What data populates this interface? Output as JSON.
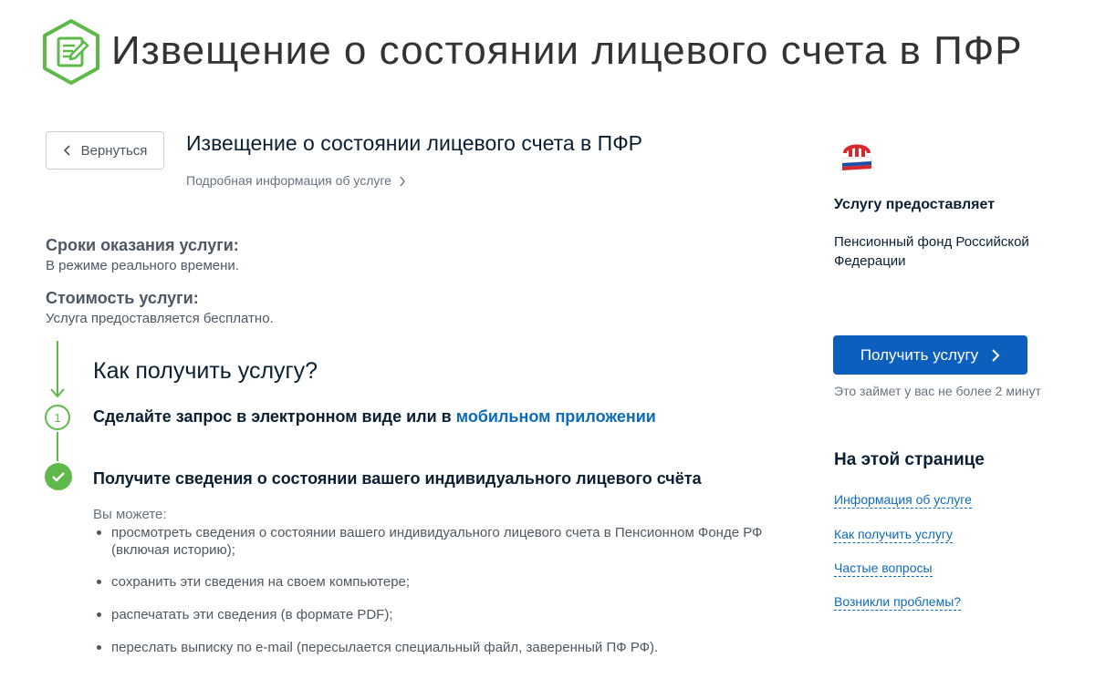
{
  "banner": {
    "title": "Извещение о состоянии лицевого счета в ПФР",
    "icon": "document-edit-icon",
    "accent_color": "#5fb94a"
  },
  "nav": {
    "back_label": "Вернуться"
  },
  "service": {
    "title": "Извещение о состоянии лицевого счета в ПФР",
    "details_link": "Подробная информация об услуге"
  },
  "info": {
    "terms_label": "Сроки оказания услуги:",
    "terms_value": "В режиме реального времени.",
    "cost_label": "Стоимость услуги:",
    "cost_value": "Услуга предоставляется бесплатно."
  },
  "how": {
    "title": "Как получить услугу?",
    "step1_number": "1",
    "step1_text": "Сделайте запрос в электронном виде или в ",
    "step1_link": "мобильном приложении",
    "step2_text": "Получите сведения о состоянии вашего индивидуального лицевого счёта",
    "can_label": "Вы можете:",
    "bullets": [
      "просмотреть сведения о состоянии вашего индивидуального лицевого счета в Пенсионном Фонде РФ (включая историю);",
      "сохранить эти сведения на своем компьютере;",
      "распечатать эти сведения (в формате PDF);",
      "переслать выписку по e-mail (пересылается специальный файл, заверенный ПФ РФ)."
    ]
  },
  "provider": {
    "logo": "pfr-logo-icon",
    "label": "Услугу предоставляет",
    "name": "Пенсионный фонд Российской Федерации"
  },
  "cta": {
    "button_label": "Получить услугу",
    "time_note": "Это займет у вас не более 2 минут",
    "button_color": "#0d5fbd"
  },
  "toc": {
    "title": "На этой странице",
    "links": [
      "Информация об услуге",
      "Как получить услугу",
      "Частые вопросы",
      "Возникли проблемы?"
    ]
  }
}
